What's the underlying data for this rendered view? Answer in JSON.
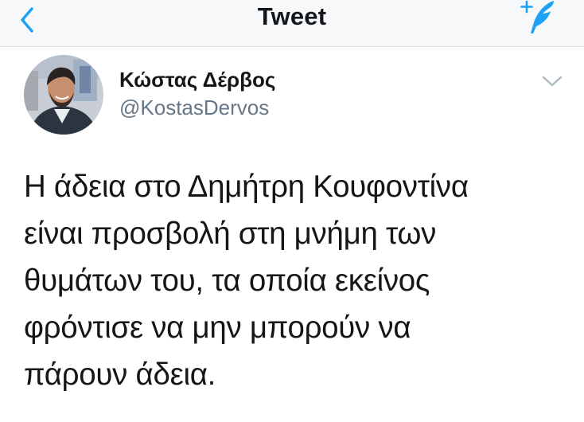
{
  "header": {
    "title": "Tweet",
    "back_icon": "chevron-left-icon",
    "compose_icon": "compose-tweet-icon",
    "accent_color": "#1da1f2"
  },
  "tweet": {
    "author": {
      "display_name": "Κώστας Δέρβος",
      "handle": "@KostasDervos",
      "avatar_icon": "avatar"
    },
    "menu_icon": "chevron-down-icon",
    "text_lines": [
      "Η άδεια στο Δημήτρη Κουφοντίνα",
      "είναι προσβολή στη μνήμη των",
      "θυμάτων του, τα οποία εκείνος",
      "φρόντισε να μην μπορούν να",
      "πάρουν άδεια."
    ]
  }
}
